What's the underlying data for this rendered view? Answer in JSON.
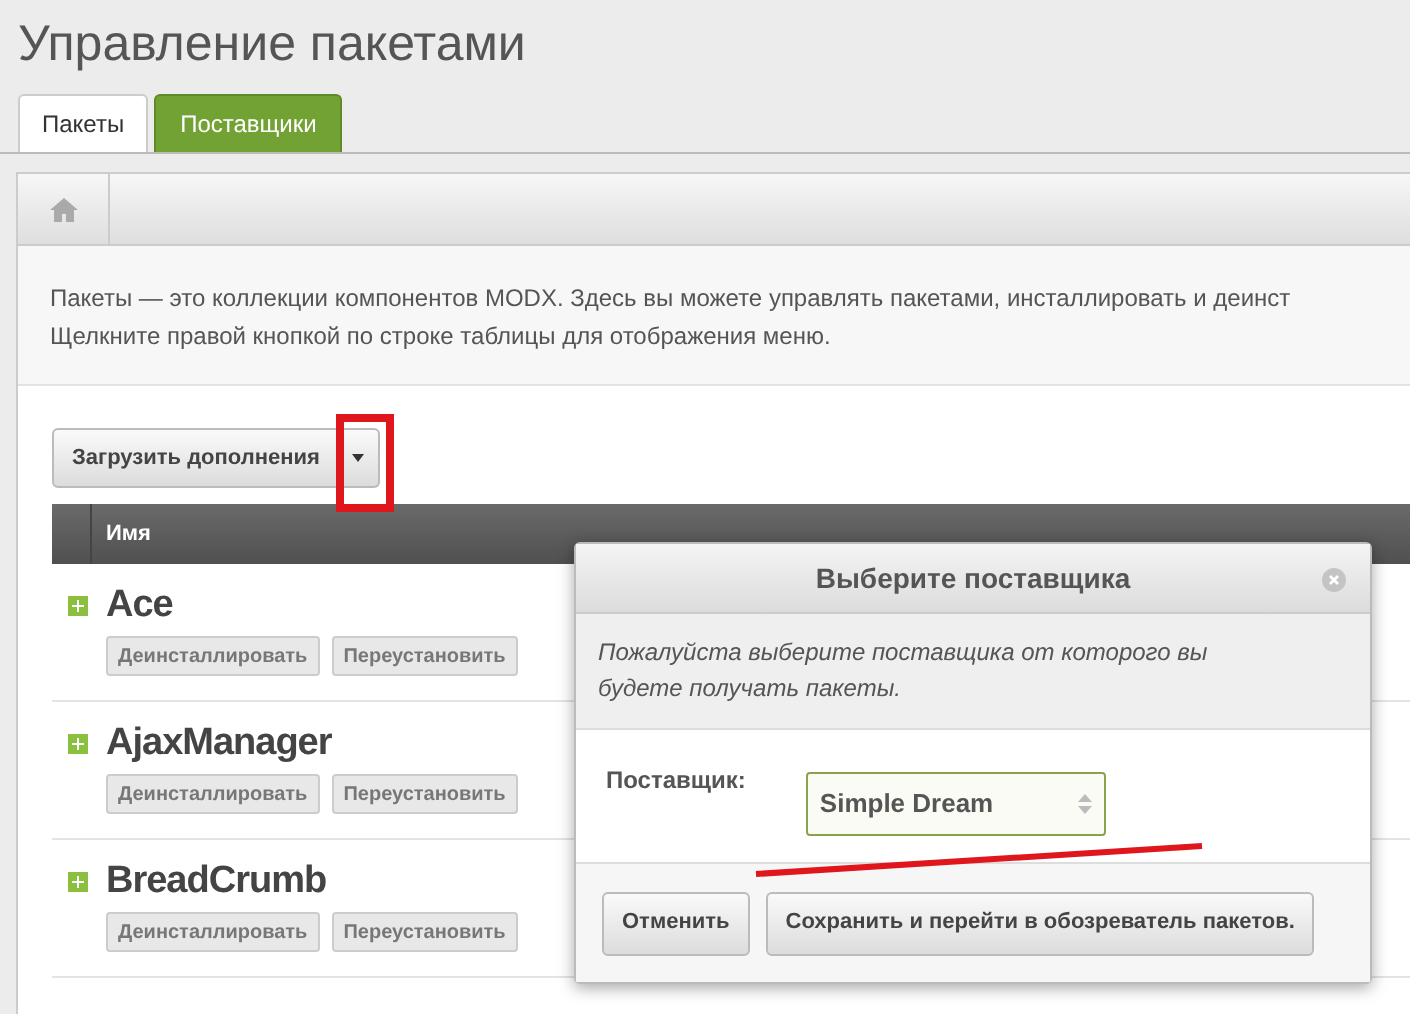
{
  "page_title": "Управление пакетами",
  "tabs": [
    {
      "label": "Пакеты",
      "selected": true
    },
    {
      "label": "Поставщики",
      "selected": false
    }
  ],
  "description": [
    "Пакеты — это коллекции компонентов MODX. Здесь вы можете управлять пакетами, инсталлировать и деинст",
    "Щелкните правой кнопкой по строке таблицы для отображения меню."
  ],
  "download_button": {
    "label": "Загрузить дополнения"
  },
  "table": {
    "columns": [
      "Имя"
    ],
    "rows": [
      {
        "name": "Ace",
        "actions": [
          "Деинсталлировать",
          "Переустановить"
        ]
      },
      {
        "name": "AjaxManager",
        "actions": [
          "Деинсталлировать",
          "Переустановить"
        ]
      },
      {
        "name": "BreadCrumb",
        "actions": [
          "Деинсталлировать",
          "Переустановить"
        ]
      }
    ]
  },
  "dialog": {
    "title": "Выберите поставщика",
    "message": "Пожалуйста выберите поставщика от которого вы будете получать пакеты.",
    "field_label": "Поставщик:",
    "field_value": "Simple Dream",
    "buttons": [
      "Отменить",
      "Сохранить и перейти в обозреватель пакетов."
    ]
  }
}
